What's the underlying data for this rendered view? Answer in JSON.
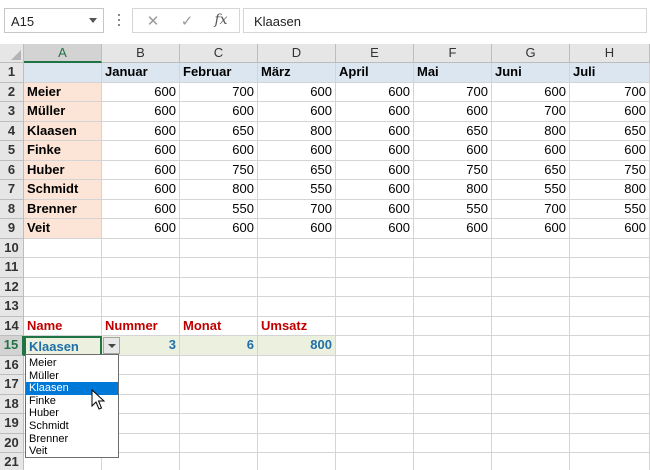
{
  "formula_bar": {
    "name_box": "A15",
    "cancel_icon": "✕",
    "enter_icon": "✓",
    "function_icon": "fx",
    "formula": "Klaasen"
  },
  "columns": [
    "A",
    "B",
    "C",
    "D",
    "E",
    "F",
    "G",
    "H"
  ],
  "rows": [
    "1",
    "2",
    "3",
    "4",
    "5",
    "6",
    "7",
    "8",
    "9",
    "10",
    "11",
    "12",
    "13",
    "14",
    "15",
    "16",
    "17",
    "18",
    "19",
    "20",
    "21"
  ],
  "table": {
    "months": [
      "Januar",
      "Februar",
      "März",
      "April",
      "Mai",
      "Juni",
      "Juli"
    ],
    "names": [
      "Meier",
      "Müller",
      "Klaasen",
      "Finke",
      "Huber",
      "Schmidt",
      "Brenner",
      "Veit"
    ],
    "values": [
      [
        "600",
        "700",
        "600",
        "600",
        "700",
        "600",
        "700"
      ],
      [
        "600",
        "600",
        "600",
        "600",
        "600",
        "700",
        "600"
      ],
      [
        "600",
        "650",
        "800",
        "600",
        "650",
        "800",
        "650"
      ],
      [
        "600",
        "600",
        "600",
        "600",
        "600",
        "600",
        "600"
      ],
      [
        "600",
        "750",
        "650",
        "600",
        "750",
        "650",
        "750"
      ],
      [
        "600",
        "800",
        "550",
        "600",
        "800",
        "550",
        "800"
      ],
      [
        "600",
        "550",
        "700",
        "600",
        "550",
        "700",
        "550"
      ],
      [
        "600",
        "600",
        "600",
        "600",
        "600",
        "600",
        "600"
      ]
    ]
  },
  "lookup": {
    "headers": [
      "Name",
      "Nummer",
      "Monat",
      "Umsatz"
    ],
    "name": "Klaasen",
    "nummer": "3",
    "monat": "6",
    "umsatz": "800"
  },
  "dropdown": {
    "options": [
      "Meier",
      "Müller",
      "Klaasen",
      "Finke",
      "Huber",
      "Schmidt",
      "Brenner",
      "Veit"
    ],
    "highlighted": "Klaasen"
  },
  "colors": {
    "accent": "#217346",
    "name_fill": "#fce4d6",
    "header_fill": "#dce6f1",
    "lookup_header": "#c00000",
    "lookup_value": "#1f6fa8",
    "selection": "#0078d7"
  }
}
